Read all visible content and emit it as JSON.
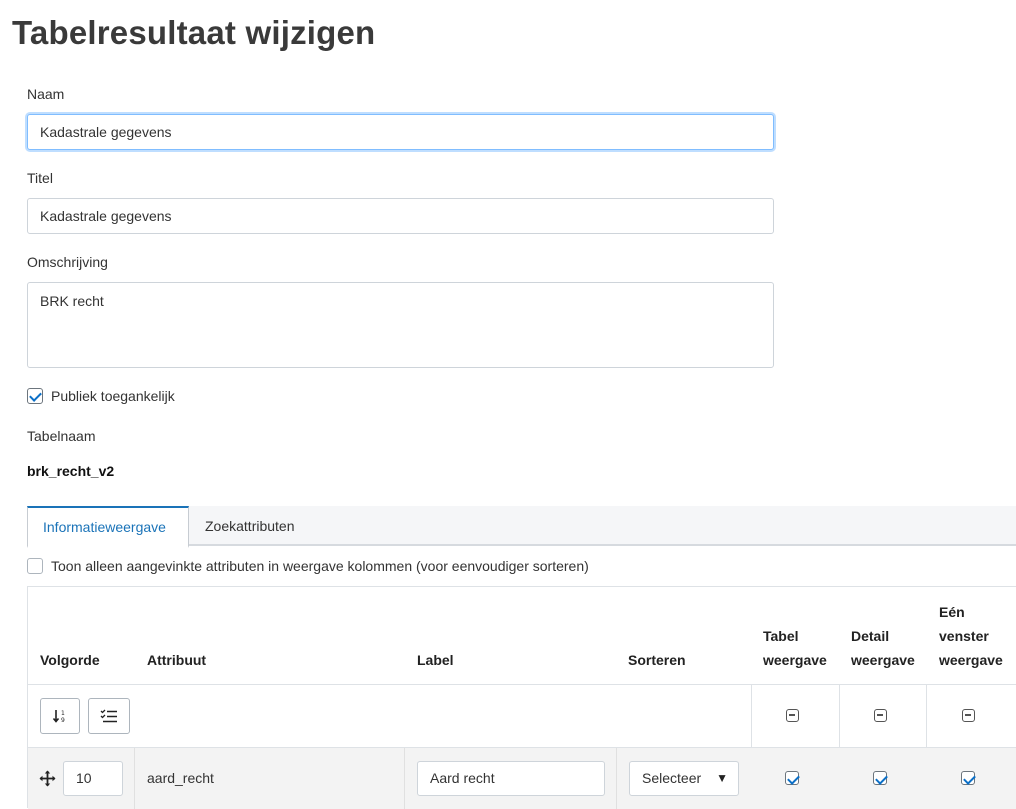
{
  "page": {
    "title": "Tabelresultaat wijzigen"
  },
  "form": {
    "naam_label": "Naam",
    "naam_value": "Kadastrale gegevens",
    "titel_label": "Titel",
    "titel_value": "Kadastrale gegevens",
    "omschrijving_label": "Omschrijving",
    "omschrijving_value": "BRK recht",
    "publiek_label": "Publiek toegankelijk",
    "publiek_checked": true,
    "tabelnaam_label": "Tabelnaam",
    "tabelnaam_value": "brk_recht_v2"
  },
  "tabs": [
    {
      "label": "Informatieweergave",
      "active": true
    },
    {
      "label": "Zoekattributen",
      "active": false
    }
  ],
  "filter": {
    "label": "Toon alleen aangevinkte attributen in weergave kolommen (voor eenvoudiger sorteren)",
    "checked": false
  },
  "table": {
    "headers": {
      "volgorde": "Volgorde",
      "attribuut": "Attribuut",
      "label": "Label",
      "sorteren": "Sorteren",
      "tabel_1": "Tabel",
      "tabel_2": "weergave",
      "detail_1": "Detail",
      "detail_2": "weergave",
      "een_1": "Eén",
      "een_2": "venster",
      "een_3": "weergave"
    },
    "rows": [
      {
        "volgorde": "10",
        "attribuut": "aard_recht",
        "label_value": "Aard recht",
        "sorteren": "Selecteer",
        "tabel": true,
        "detail": true,
        "een": true
      }
    ]
  },
  "icons": {
    "sort": "sort-order-icon",
    "checklist": "checklist-icon",
    "move": "move-icon",
    "indeterminate": "indeterminate-checkbox-icon"
  },
  "colors": {
    "accent": "#1a73b8",
    "check": "#0b6fc7"
  }
}
